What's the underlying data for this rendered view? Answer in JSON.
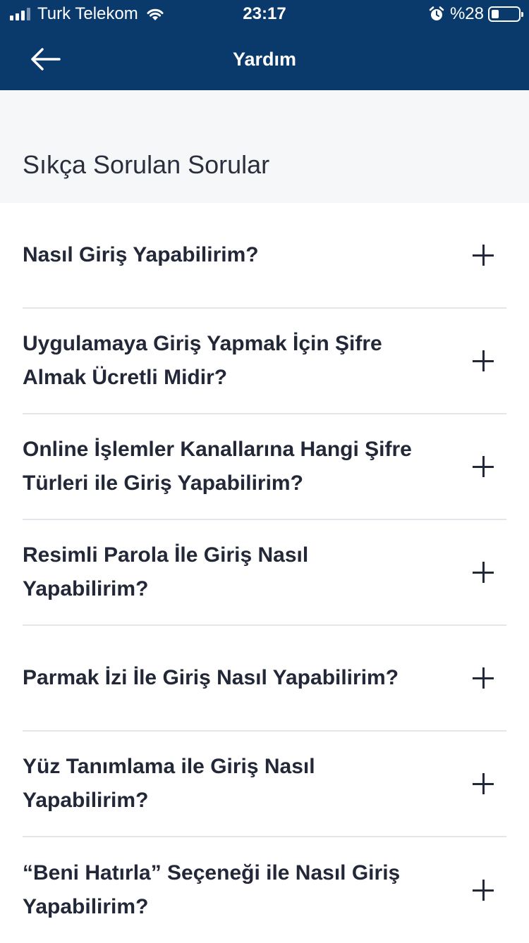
{
  "status_bar": {
    "carrier": "Turk Telekom",
    "time": "23:17",
    "battery_percent": "%28",
    "battery_level": 0.28,
    "icons": [
      "signal-icon",
      "wifi-icon",
      "alarm-icon",
      "battery-icon"
    ]
  },
  "nav": {
    "title": "Yardım",
    "back_icon": "arrow-left-icon"
  },
  "section": {
    "title": "Sıkça Sorulan Sorular"
  },
  "faq": [
    {
      "question": "Nasıl Giriş Yapabilirim?",
      "icon": "plus-icon"
    },
    {
      "question": "Uygulamaya Giriş Yapmak İçin Şifre Almak Ücretli Midir?",
      "icon": "plus-icon"
    },
    {
      "question": "Online İşlemler Kanallarına Hangi Şifre Türleri ile Giriş Yapabilirim?",
      "icon": "plus-icon"
    },
    {
      "question": "Resimli Parola İle Giriş Nasıl Yapabilirim?",
      "icon": "plus-icon"
    },
    {
      "question": "Parmak İzi İle Giriş Nasıl Yapabilirim?",
      "icon": "plus-icon"
    },
    {
      "question": "Yüz Tanımlama ile Giriş Nasıl Yapabilirim?",
      "icon": "plus-icon"
    },
    {
      "question": "“Beni Hatırla” Seçeneği ile Nasıl Giriş Yapabilirim?",
      "icon": "plus-icon"
    }
  ],
  "colors": {
    "header_bg": "#0a3a6c",
    "section_bg": "#f6f7f9",
    "text": "#232838",
    "divider": "#e3e6ea"
  }
}
